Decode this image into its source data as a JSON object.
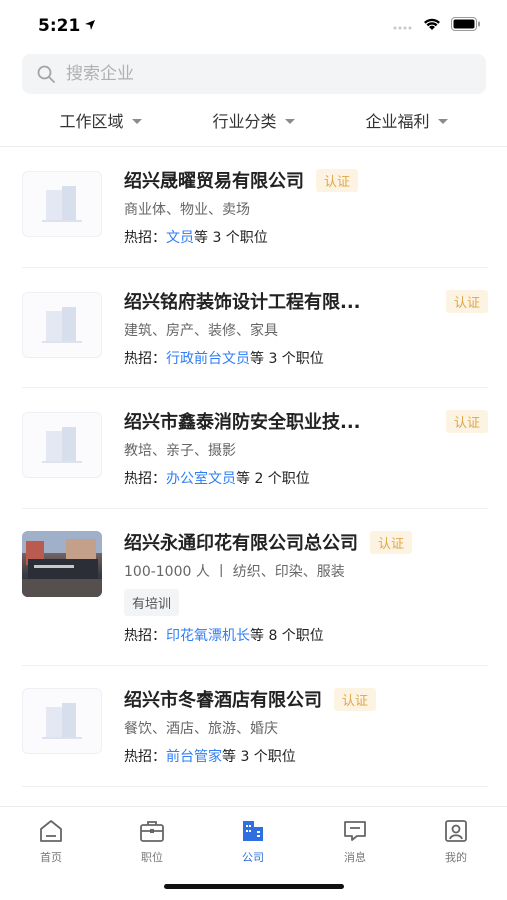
{
  "status_bar": {
    "time": "5:21"
  },
  "search": {
    "placeholder": "搜索企业"
  },
  "filters": [
    {
      "label": "工作区域"
    },
    {
      "label": "行业分类"
    },
    {
      "label": "企业福利"
    }
  ],
  "companies": [
    {
      "name": "绍兴晟曜贸易有限公司",
      "badge": "认证",
      "industry": "商业体、物业、卖场",
      "hot_prefix": "热招：",
      "hot_job": "文员",
      "hot_suffix": "等 3 个职位"
    },
    {
      "name": "绍兴铭府装饰设计工程有限...",
      "badge": "认证",
      "industry": "建筑、房产、装修、家具",
      "hot_prefix": "热招：",
      "hot_job": "行政前台文员",
      "hot_suffix": "等 3 个职位"
    },
    {
      "name": "绍兴市鑫泰消防安全职业技...",
      "badge": "认证",
      "industry": "教培、亲子、摄影",
      "hot_prefix": "热招：",
      "hot_job": "办公室文员",
      "hot_suffix": "等 2 个职位"
    },
    {
      "name": "绍兴永通印花有限公司总公司",
      "badge": "认证",
      "industry": "100-1000 人 丨 纺织、印染、服装",
      "tag": "有培训",
      "hot_prefix": "热招：",
      "hot_job": "印花氧漂机长",
      "hot_suffix": "等 8 个职位"
    },
    {
      "name": "绍兴市冬睿酒店有限公司",
      "badge": "认证",
      "industry": "餐饮、酒店、旅游、婚庆",
      "hot_prefix": "热招：",
      "hot_job": "前台管家",
      "hot_suffix": "等 3 个职位"
    }
  ],
  "tabs": [
    {
      "label": "首页",
      "icon": "home-icon"
    },
    {
      "label": "职位",
      "icon": "briefcase-icon"
    },
    {
      "label": "公司",
      "icon": "building-icon",
      "active": true
    },
    {
      "label": "消息",
      "icon": "message-icon"
    },
    {
      "label": "我的",
      "icon": "profile-icon"
    }
  ],
  "colors": {
    "accent": "#2f6fe0",
    "link": "#2f7ef5",
    "badge_bg": "#fdf3e2",
    "badge_text": "#e0a64a"
  }
}
